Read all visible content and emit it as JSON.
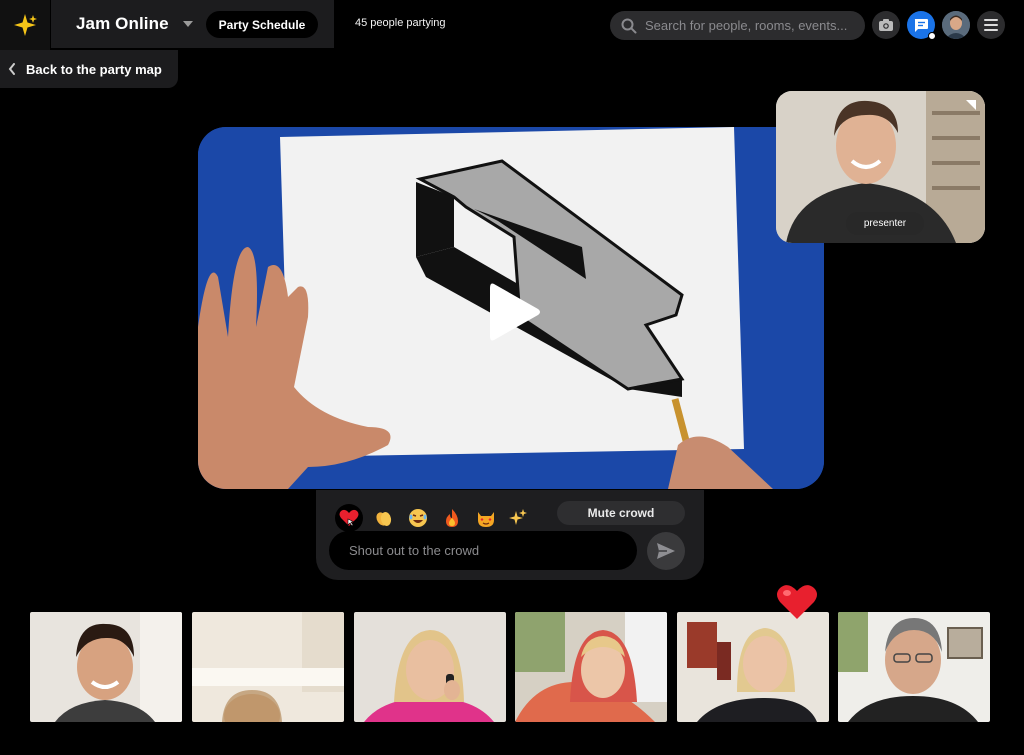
{
  "header": {
    "venue_name": "Jam Online",
    "schedule_label": "Party Schedule",
    "people_count_text": "45 people partying",
    "search_placeholder": "Search for people, rooms, events..."
  },
  "navigation": {
    "back_label": "Back to the party map"
  },
  "presenter": {
    "label": "presenter"
  },
  "reactions": {
    "emojis": [
      "heart",
      "clapping-hands",
      "laughing-face",
      "fire",
      "heart-eyes-cat",
      "sparkles"
    ],
    "mute_label": "Mute crowd",
    "shout_placeholder": "Shout out to the crowd"
  },
  "participants": [
    {
      "name": "participant-1"
    },
    {
      "name": "participant-2"
    },
    {
      "name": "participant-3"
    },
    {
      "name": "participant-4"
    },
    {
      "name": "participant-5"
    },
    {
      "name": "participant-6"
    }
  ],
  "colors": {
    "accent": "#1a73e8",
    "background": "#000000",
    "panel": "#1e1e20",
    "video_bg": "#1b48a8",
    "heart": "#e8202e"
  }
}
